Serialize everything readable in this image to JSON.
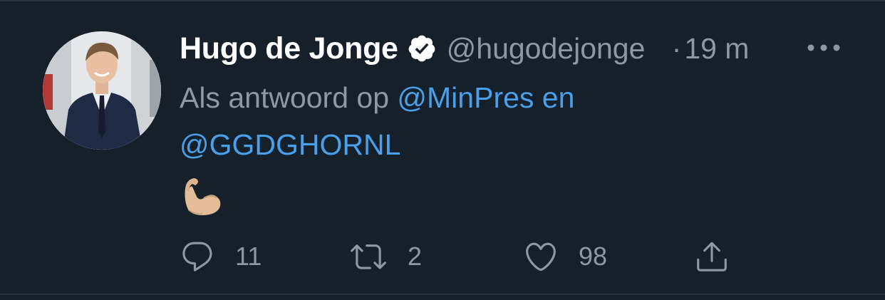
{
  "tweet": {
    "author": {
      "display_name": "Hugo de Jonge",
      "handle": "@hugodejonge",
      "verified": true
    },
    "separator": "·",
    "time": "19 m",
    "reply_prefix": "Als antwoord op ",
    "mentions": [
      "@MinPres",
      "@GGDGHORNL"
    ],
    "mention_joiner": " en",
    "body_emoji": "💪🏼",
    "actions": {
      "reply_count": "11",
      "retweet_count": "2",
      "like_count": "98"
    }
  },
  "icons": {
    "more": "more-horizontal-icon",
    "verified": "verified-badge-icon",
    "reply": "reply-icon",
    "retweet": "retweet-icon",
    "like": "heart-icon",
    "share": "share-icon"
  },
  "colors": {
    "background": "#16202b",
    "text_primary": "#ffffff",
    "text_secondary": "#8b98a5",
    "link": "#4a9fea"
  }
}
